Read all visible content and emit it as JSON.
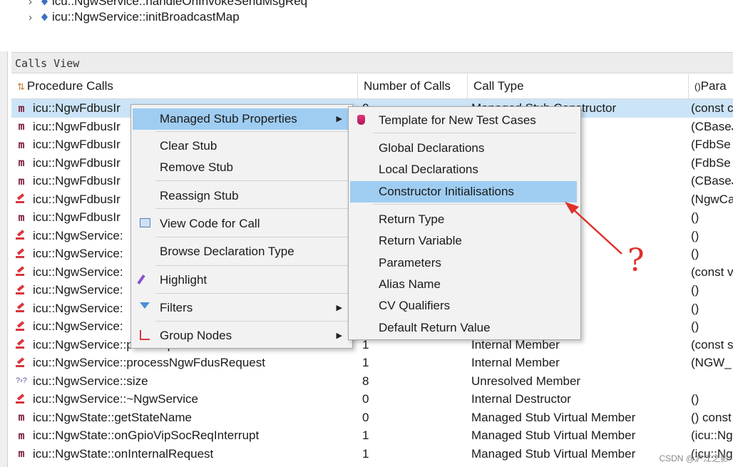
{
  "tree": {
    "items": [
      {
        "label": "icu::NgwService::handleOnInvokeSendMsgReq"
      },
      {
        "label": "icu::NgwService::initBroadcastMap"
      }
    ]
  },
  "calls_view": {
    "title": "Calls View",
    "columns": [
      "Procedure Calls",
      "Number of Calls",
      "Call Type",
      "Para"
    ],
    "rows": [
      {
        "icon": "managed",
        "name": "icu::NgwFdbusIr",
        "count": "0",
        "type": "Managed Stub Constructor",
        "params": "(const c"
      },
      {
        "icon": "managed",
        "name": "icu::NgwFdbusIr",
        "count": "",
        "type": "ember",
        "params": "(CBaseJ"
      },
      {
        "icon": "managed",
        "name": "icu::NgwFdbusIr",
        "count": "",
        "type": "ember",
        "params": "(FdbSe"
      },
      {
        "icon": "managed",
        "name": "icu::NgwFdbusIr",
        "count": "",
        "type": "ember",
        "params": "(FdbSe"
      },
      {
        "icon": "managed",
        "name": "icu::NgwFdbusIr",
        "count": "",
        "type": "ember",
        "params": "(CBaseJ"
      },
      {
        "icon": "internal",
        "name": "icu::NgwFdbusIr",
        "count": "",
        "type": "",
        "params": "(NgwCa"
      },
      {
        "icon": "managed",
        "name": "icu::NgwFdbusIr",
        "count": "",
        "type": "rtual Destructor",
        "params": "()"
      },
      {
        "icon": "internal",
        "name": "icu::NgwService:",
        "count": "",
        "type": "or",
        "params": "()"
      },
      {
        "icon": "internal",
        "name": "icu::NgwService:",
        "count": "",
        "type": "",
        "params": "()"
      },
      {
        "icon": "internal",
        "name": "icu::NgwService:",
        "count": "",
        "type": "",
        "params": "(const v"
      },
      {
        "icon": "internal",
        "name": "icu::NgwService:",
        "count": "",
        "type": "",
        "params": "()"
      },
      {
        "icon": "internal",
        "name": "icu::NgwService:",
        "count": "",
        "type": "",
        "params": "()"
      },
      {
        "icon": "internal",
        "name": "icu::NgwService:",
        "count": "",
        "type": "",
        "params": "()"
      },
      {
        "icon": "internal",
        "name": "icu::NgwService::parseVipRxDataCallback",
        "count": "1",
        "type": "Internal Member",
        "params": "(const s"
      },
      {
        "icon": "internal",
        "name": "icu::NgwService::processNgwFdusRequest",
        "count": "1",
        "type": "Internal Member",
        "params": "(NGW_"
      },
      {
        "icon": "unresolved",
        "name": "icu::NgwService::size",
        "count": "8",
        "type": "Unresolved Member",
        "params": ""
      },
      {
        "icon": "internal",
        "name": "icu::NgwService::~NgwService",
        "count": "0",
        "type": "Internal Destructor",
        "params": "()"
      },
      {
        "icon": "managed",
        "name": "icu::NgwState::getStateName",
        "count": "0",
        "type": "Managed Stub Virtual Member",
        "params": "() const"
      },
      {
        "icon": "managed",
        "name": "icu::NgwState::onGpioVipSocReqInterrupt",
        "count": "1",
        "type": "Managed Stub Virtual Member",
        "params": "(icu::Ng"
      },
      {
        "icon": "managed",
        "name": "icu::NgwState::onInternalRequest",
        "count": "1",
        "type": "Managed Stub Virtual Member",
        "params": "(icu::Ng"
      }
    ]
  },
  "context_menu": {
    "items": [
      {
        "label": "Managed Stub Properties",
        "submenu": true,
        "highlighted": true
      },
      {
        "label": "Clear Stub"
      },
      {
        "label": "Remove Stub"
      },
      {
        "label": "Reassign Stub"
      },
      {
        "label": "View Code for Call",
        "icon": "view-code-icon"
      },
      {
        "label": "Browse Declaration Type"
      },
      {
        "label": "Highlight",
        "icon": "highlight-icon"
      },
      {
        "label": "Filters",
        "icon": "filter-icon",
        "submenu": true
      },
      {
        "label": "Group Nodes",
        "icon": "group-nodes-icon",
        "submenu": true
      }
    ]
  },
  "submenu": {
    "items": [
      {
        "label": "Template for New Test Cases",
        "icon": "database-icon"
      },
      {
        "label": "Global Declarations"
      },
      {
        "label": "Local Declarations"
      },
      {
        "label": "Constructor Initialisations",
        "highlighted": true
      },
      {
        "label": "Return Type"
      },
      {
        "label": "Return Variable"
      },
      {
        "label": "Parameters"
      },
      {
        "label": "Alias Name"
      },
      {
        "label": "CV Qualifiers"
      },
      {
        "label": "Default Return Value"
      }
    ]
  },
  "annotation": {
    "mark": "?",
    "color": "#e0302a"
  },
  "watermark": "CSDN @沪江之影"
}
